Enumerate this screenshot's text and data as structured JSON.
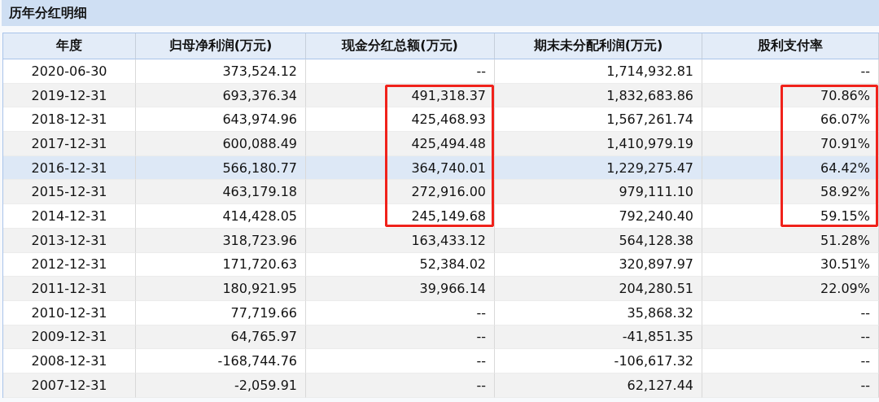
{
  "panel": {
    "title": "历年分红明细"
  },
  "table": {
    "columns": [
      "年度",
      "归母净利润(万元)",
      "现金分红总额(万元)",
      "期末未分配利润(万元)",
      "股利支付率"
    ],
    "rows": [
      {
        "cells": [
          "2020-06-30",
          "373,524.12",
          "--",
          "1,714,932.81",
          "--"
        ],
        "selected": false,
        "highlighted": false
      },
      {
        "cells": [
          "2019-12-31",
          "693,376.34",
          "491,318.37",
          "1,832,683.86",
          "70.86%"
        ],
        "selected": false,
        "highlighted": true
      },
      {
        "cells": [
          "2018-12-31",
          "643,974.96",
          "425,468.93",
          "1,567,261.74",
          "66.07%"
        ],
        "selected": false,
        "highlighted": true
      },
      {
        "cells": [
          "2017-12-31",
          "600,088.49",
          "425,494.48",
          "1,410,979.19",
          "70.91%"
        ],
        "selected": false,
        "highlighted": true
      },
      {
        "cells": [
          "2016-12-31",
          "566,180.77",
          "364,740.01",
          "1,229,275.47",
          "64.42%"
        ],
        "selected": true,
        "highlighted": true
      },
      {
        "cells": [
          "2015-12-31",
          "463,179.18",
          "272,916.00",
          "979,111.10",
          "58.92%"
        ],
        "selected": false,
        "highlighted": true
      },
      {
        "cells": [
          "2014-12-31",
          "414,428.05",
          "245,149.68",
          "792,240.40",
          "59.15%"
        ],
        "selected": false,
        "highlighted": true
      },
      {
        "cells": [
          "2013-12-31",
          "318,723.96",
          "163,433.12",
          "564,128.38",
          "51.28%"
        ],
        "selected": false,
        "highlighted": false
      },
      {
        "cells": [
          "2012-12-31",
          "171,720.63",
          "52,384.02",
          "320,897.97",
          "30.51%"
        ],
        "selected": false,
        "highlighted": false
      },
      {
        "cells": [
          "2011-12-31",
          "180,921.95",
          "39,966.14",
          "204,280.51",
          "22.09%"
        ],
        "selected": false,
        "highlighted": false
      },
      {
        "cells": [
          "2010-12-31",
          "77,719.66",
          "--",
          "35,868.32",
          "--"
        ],
        "selected": false,
        "highlighted": false
      },
      {
        "cells": [
          "2009-12-31",
          "64,765.97",
          "--",
          "-41,851.35",
          "--"
        ],
        "selected": false,
        "highlighted": false
      },
      {
        "cells": [
          "2008-12-31",
          "-168,744.76",
          "--",
          "-106,617.32",
          "--"
        ],
        "selected": false,
        "highlighted": false
      },
      {
        "cells": [
          "2007-12-31",
          "-2,059.91",
          "--",
          "62,127.44",
          "--"
        ],
        "selected": false,
        "highlighted": false
      }
    ]
  }
}
